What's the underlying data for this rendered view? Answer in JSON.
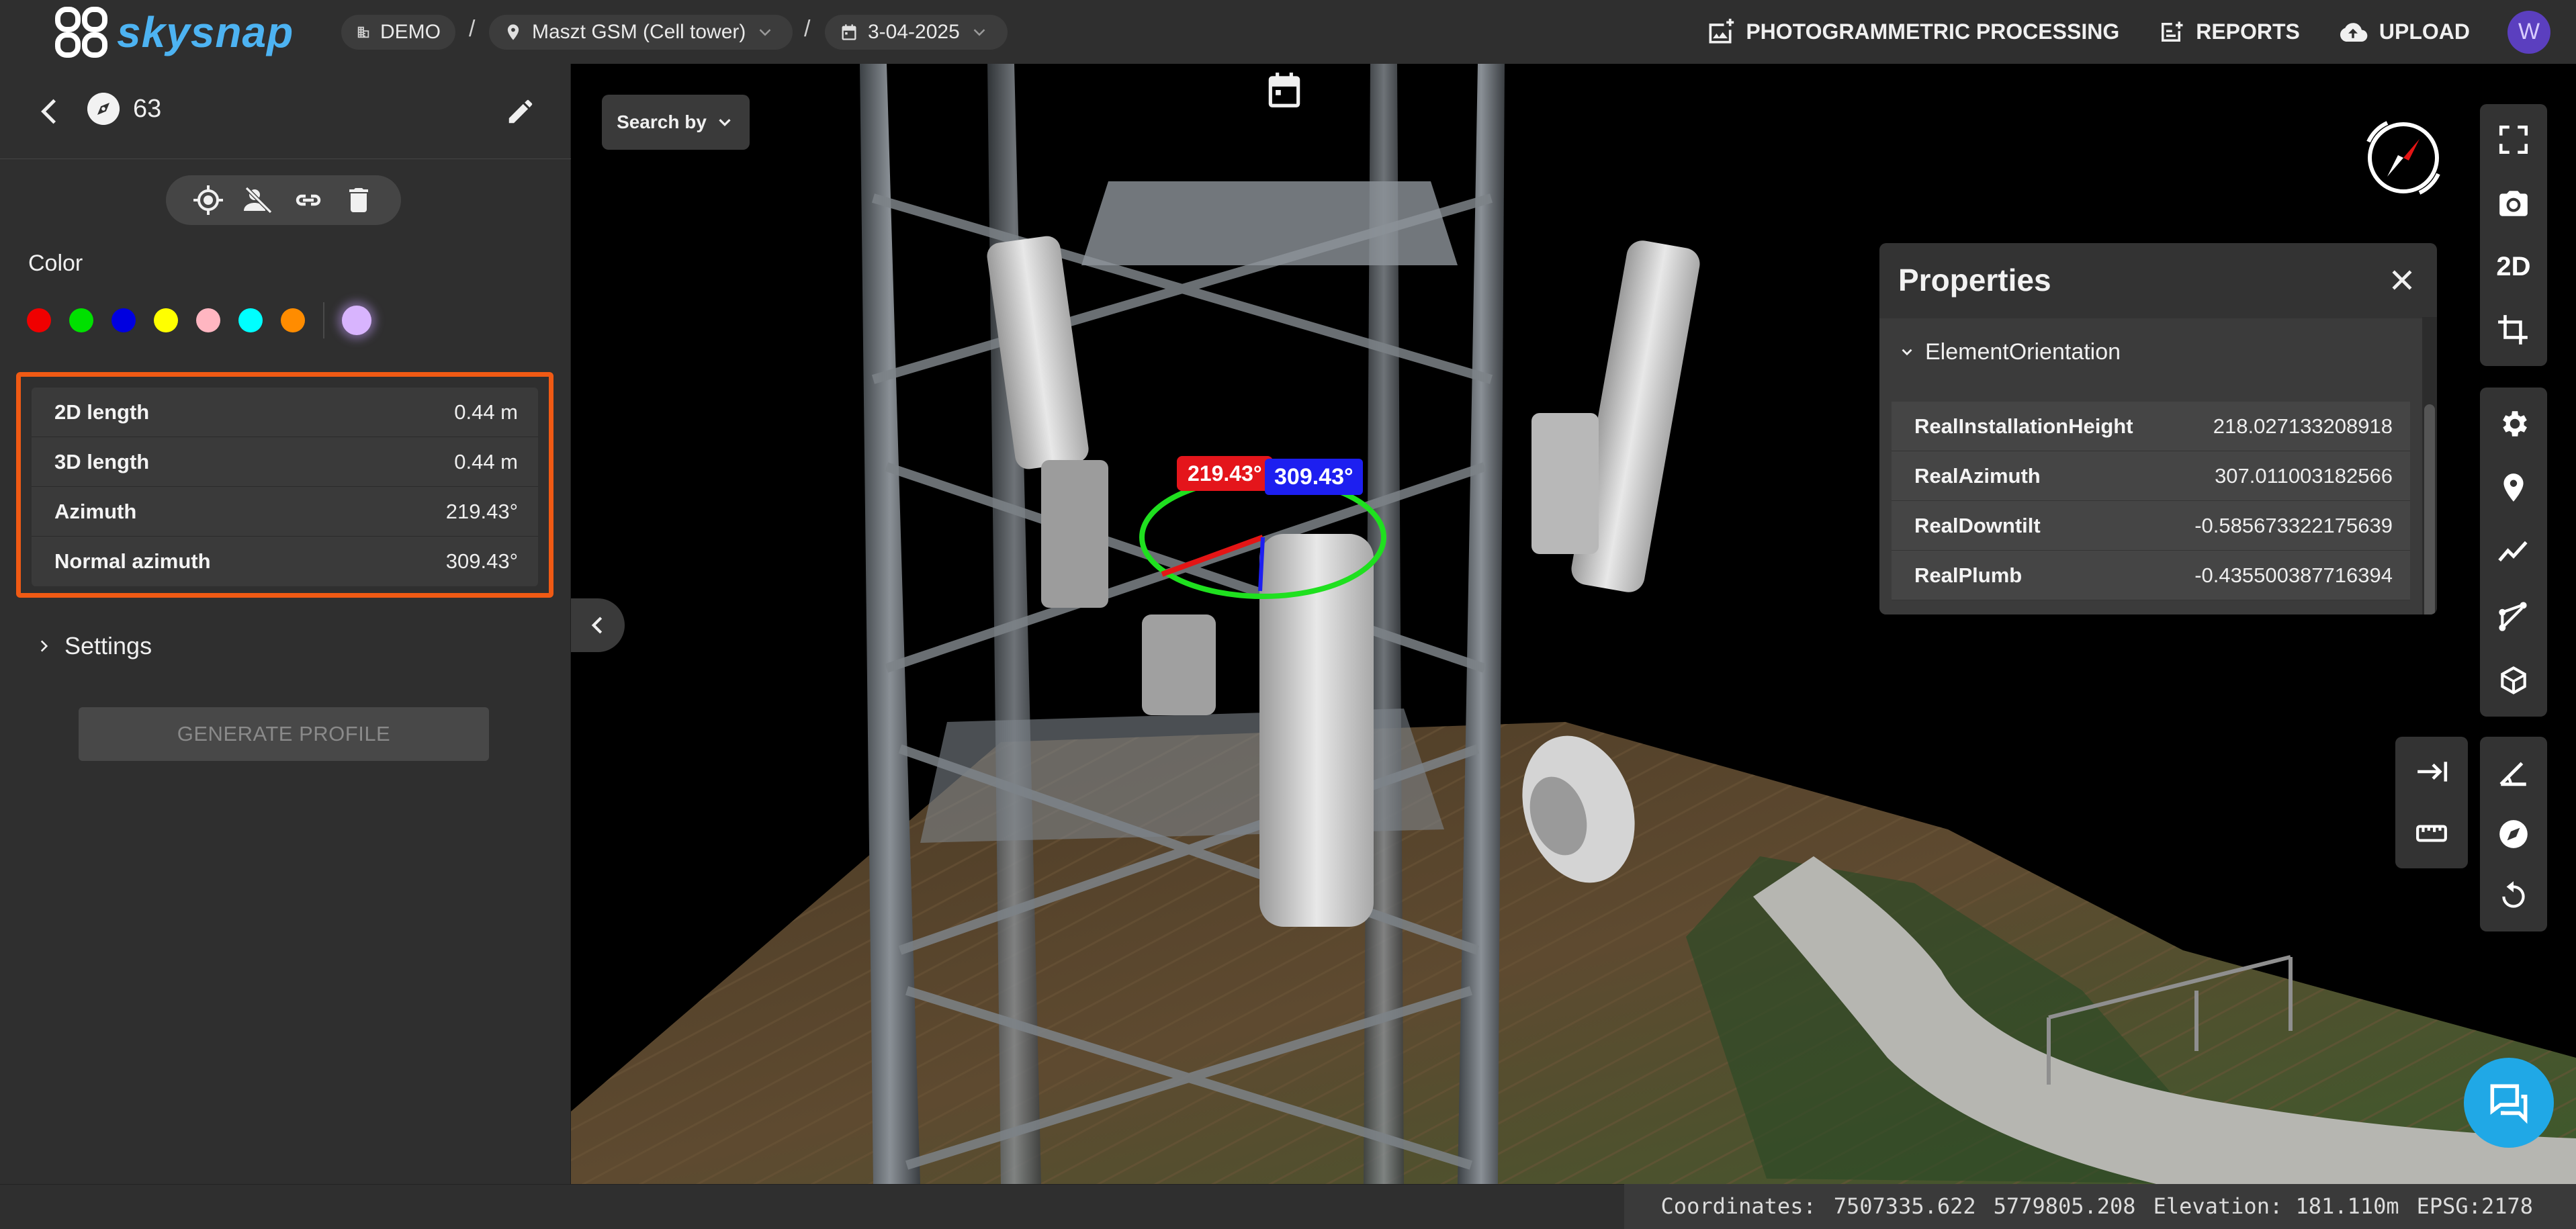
{
  "app": {
    "brand": "skysnap"
  },
  "breadcrumb": {
    "org": "DEMO",
    "site": "Maszt GSM (Cell tower)",
    "date": "3-04-2025",
    "separator": "/"
  },
  "top_actions": {
    "photogrammetry": "PHOTOGRAMMETRIC PROCESSING",
    "reports": "REPORTS",
    "upload": "UPLOAD",
    "avatar_initial": "W"
  },
  "left_panel": {
    "item_id": "63",
    "color_label": "Color",
    "colors": [
      "#f00000",
      "#00e000",
      "#0000e0",
      "#ffff00",
      "#ffb6c1",
      "#00ffff",
      "#ff8c00"
    ],
    "selected_color": "#d8b4fe",
    "measurements": [
      {
        "key": "2D length",
        "value": "0.44 m"
      },
      {
        "key": "3D length",
        "value": "0.44 m"
      },
      {
        "key": "Azimuth",
        "value": "219.43°"
      },
      {
        "key": "Normal azimuth",
        "value": "309.43°"
      }
    ],
    "settings_label": "Settings",
    "generate_label": "GENERATE PROFILE"
  },
  "viewport": {
    "search_by": "Search by",
    "azimuth_label": "219.43°",
    "normal_azimuth_label": "309.43°"
  },
  "properties": {
    "title": "Properties",
    "section": "ElementOrientation",
    "rows": [
      {
        "key": "RealInstallationHeight",
        "value": "218.027133208918"
      },
      {
        "key": "RealAzimuth",
        "value": "307.011003182566"
      },
      {
        "key": "RealDowntilt",
        "value": "-0.585673322175639"
      },
      {
        "key": "RealPlumb",
        "value": "-0.435500387716394"
      }
    ]
  },
  "toolbar": {
    "mode_2d": "2D"
  },
  "status": {
    "coordinates_label": "Coordinates:",
    "x": "7507335.622",
    "y": "5779805.208",
    "elevation": "Elevation: 181.110m",
    "epsg": "EPSG:2178"
  }
}
